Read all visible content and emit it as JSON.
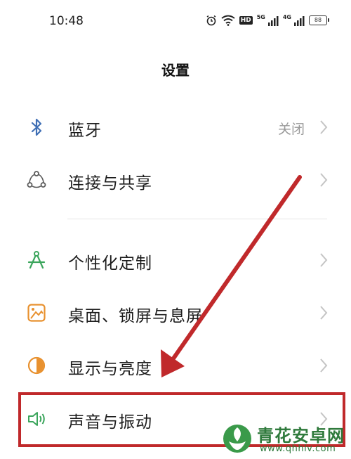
{
  "status_bar": {
    "time": "10:48",
    "hd_label": "HD",
    "net1_label": "5G",
    "net2_label": "4G",
    "battery": "88"
  },
  "page": {
    "title": "设置"
  },
  "settings": {
    "bluetooth": {
      "label": "蓝牙",
      "value": "关闭",
      "icon": "bluetooth-icon"
    },
    "connection": {
      "label": "连接与共享",
      "icon": "share-icon"
    },
    "personalize": {
      "label": "个性化定制",
      "icon": "compass-icon"
    },
    "desktop": {
      "label": "桌面、锁屏与息屏",
      "icon": "wallpaper-icon"
    },
    "display": {
      "label": "显示与亮度",
      "icon": "brightness-icon"
    },
    "sound": {
      "label": "声音与振动",
      "icon": "speaker-icon"
    }
  },
  "watermark": {
    "title": "青花安卓网",
    "url": "www.qhhlv.com"
  },
  "colors": {
    "annotation_red": "#c0292b",
    "bluetooth_blue": "#3f6fb5",
    "icon_green": "#3ba55c",
    "icon_orange": "#e8912f",
    "watermark_green": "#2f7a3c"
  }
}
